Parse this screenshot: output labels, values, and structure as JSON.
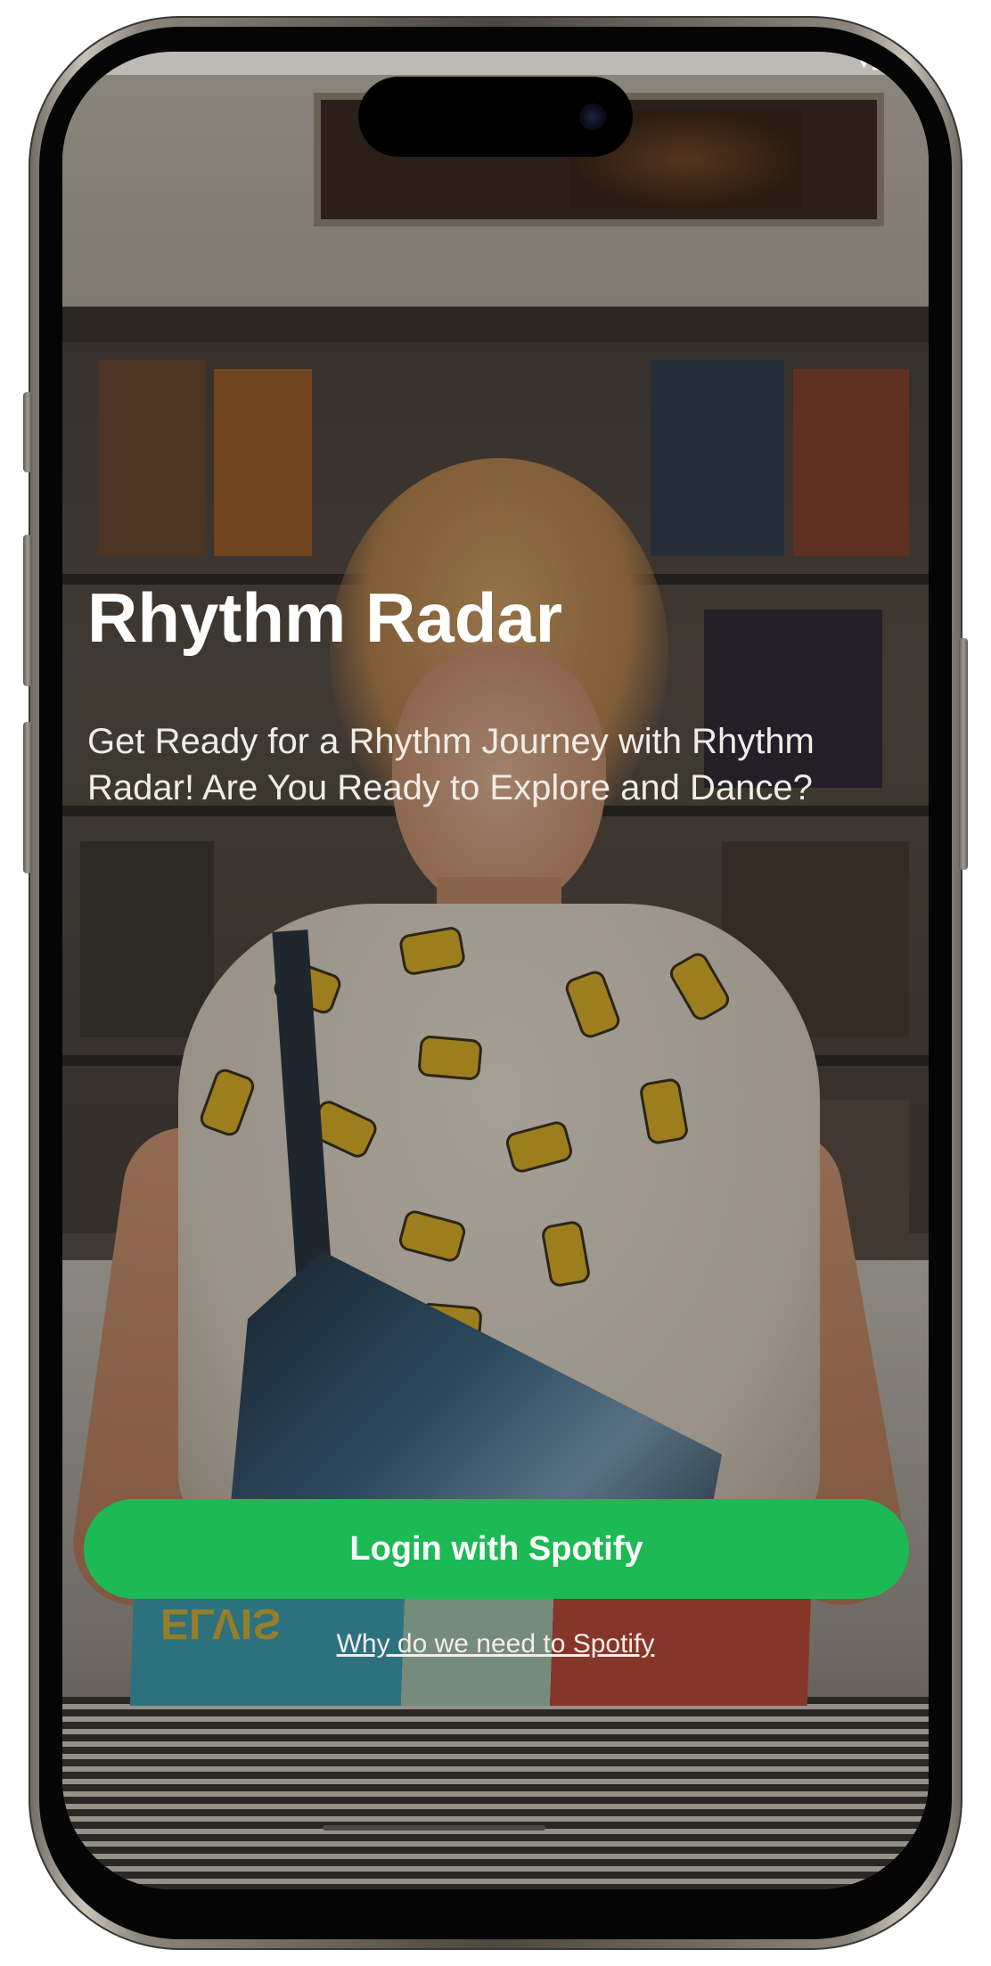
{
  "app": {
    "title": "Rhythm Radar",
    "tagline": "Get Ready for a Rhythm Journey with Rhythm Radar! Are You Ready to Explore and Dance?"
  },
  "actions": {
    "login_label": "Login with Spotify",
    "why_label": "Why do we need to Spotify"
  },
  "background": {
    "album_text": "ELVIS"
  },
  "colors": {
    "accent": "#1db954",
    "text": "#ffffff"
  },
  "icons": {
    "status": [
      "wifi-icon",
      "battery-icon"
    ]
  }
}
